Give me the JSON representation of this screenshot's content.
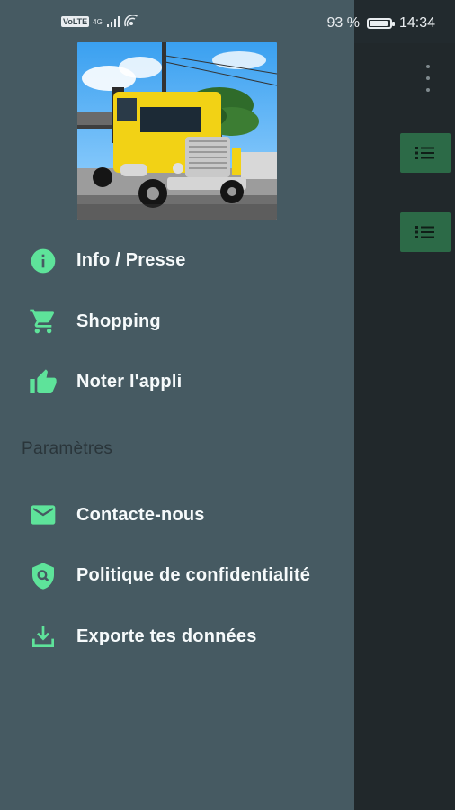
{
  "status_bar": {
    "carrier": "VoLTE",
    "network": "4G",
    "battery_percent": "93 %",
    "battery_level": 0.93,
    "time": "14:34"
  },
  "drawer": {
    "header_image": "yellow-truck-photo",
    "menu": [
      {
        "label": "Info / Presse",
        "icon": "info-icon"
      },
      {
        "label": "Shopping",
        "icon": "cart-icon"
      },
      {
        "label": "Noter l'appli",
        "icon": "thumb-up-icon"
      }
    ],
    "settings_title": "Paramètres",
    "settings": [
      {
        "label": "Contacte-nous",
        "icon": "email-icon"
      },
      {
        "label": "Politique de confidentialité",
        "icon": "shield-search-icon"
      },
      {
        "label": "Exporte tes données",
        "icon": "download-icon"
      }
    ]
  },
  "colors": {
    "drawer_bg": "#465a62",
    "accent": "#5ee39a",
    "list_button": "#2c6a47"
  }
}
